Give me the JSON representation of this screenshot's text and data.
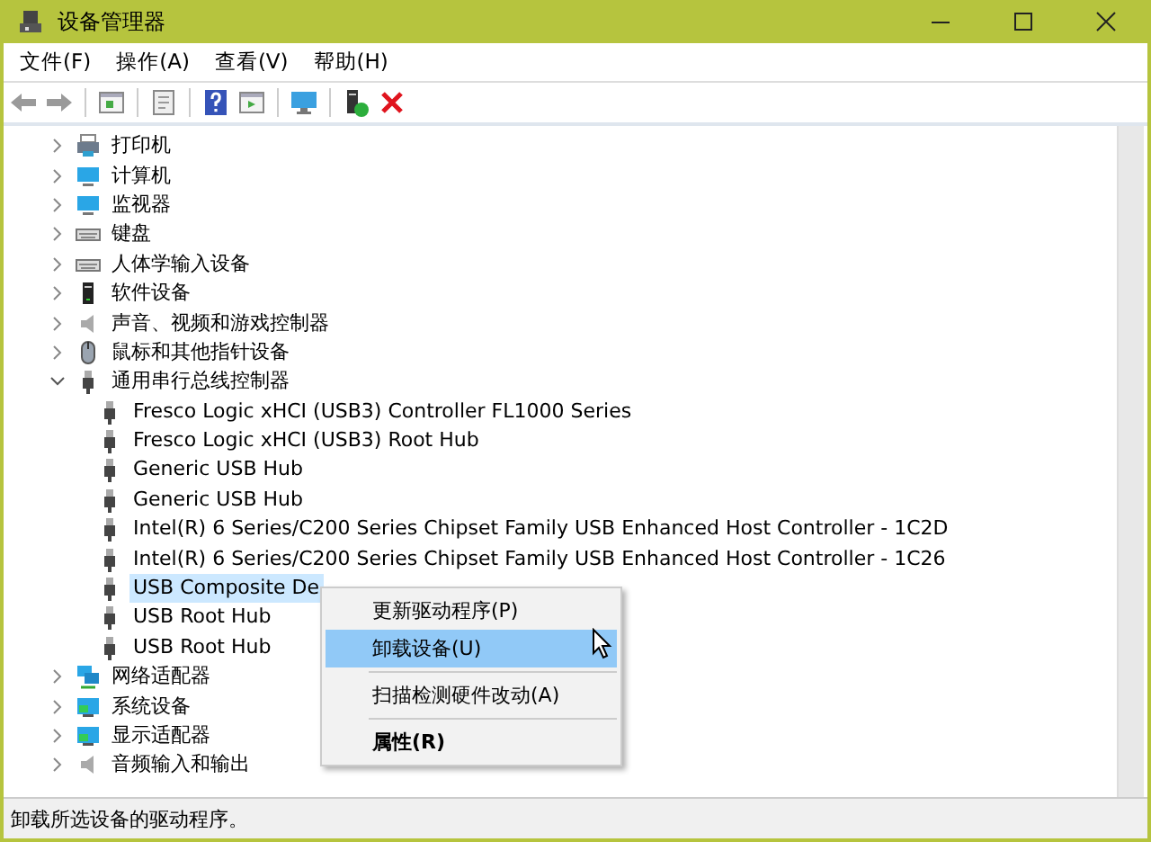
{
  "window": {
    "title": "设备管理器"
  },
  "menu": [
    {
      "label": "文件(F)"
    },
    {
      "label": "操作(A)"
    },
    {
      "label": "查看(V)"
    },
    {
      "label": "帮助(H)"
    }
  ],
  "tree": [
    {
      "label": "打印机",
      "expanded": false,
      "selected": false
    },
    {
      "label": "计算机",
      "expanded": false,
      "selected": false
    },
    {
      "label": "监视器",
      "expanded": false,
      "selected": false
    },
    {
      "label": "键盘",
      "expanded": false,
      "selected": false
    },
    {
      "label": "人体学输入设备",
      "expanded": false,
      "selected": false
    },
    {
      "label": "软件设备",
      "expanded": false,
      "selected": false
    },
    {
      "label": "声音、视频和游戏控制器",
      "expanded": false,
      "selected": false
    },
    {
      "label": "鼠标和其他指针设备",
      "expanded": false,
      "selected": false
    },
    {
      "label": "通用串行总线控制器",
      "expanded": true,
      "selected": false,
      "children": [
        {
          "label": "Fresco Logic xHCI (USB3) Controller FL1000 Series",
          "selected": false
        },
        {
          "label": "Fresco Logic xHCI (USB3) Root Hub",
          "selected": false
        },
        {
          "label": "Generic USB Hub",
          "selected": false
        },
        {
          "label": "Generic USB Hub",
          "selected": false
        },
        {
          "label": "Intel(R) 6 Series/C200 Series Chipset Family USB Enhanced Host Controller - 1C2D",
          "selected": false
        },
        {
          "label": "Intel(R) 6 Series/C200 Series Chipset Family USB Enhanced Host Controller - 1C26",
          "selected": false
        },
        {
          "label": "USB Composite De",
          "selected": true
        },
        {
          "label": "USB Root Hub",
          "selected": false
        },
        {
          "label": "USB Root Hub",
          "selected": false
        }
      ]
    },
    {
      "label": "网络适配器",
      "expanded": false,
      "selected": false
    },
    {
      "label": "系统设备",
      "expanded": false,
      "selected": false
    },
    {
      "label": "显示适配器",
      "expanded": false,
      "selected": false
    },
    {
      "label": "音频输入和输出",
      "expanded": false,
      "selected": false
    }
  ],
  "context_menu": [
    {
      "label": "更新驱动程序(P)",
      "selected": false,
      "bold": false,
      "separator_after": false
    },
    {
      "label": "卸载设备(U)",
      "selected": true,
      "bold": false,
      "separator_after": true
    },
    {
      "label": "扫描检测硬件改动(A)",
      "selected": false,
      "bold": false,
      "separator_after": true
    },
    {
      "label": "属性(R)",
      "selected": false,
      "bold": true,
      "separator_after": false
    }
  ],
  "status_bar": "卸载所选设备的驱动程序。"
}
